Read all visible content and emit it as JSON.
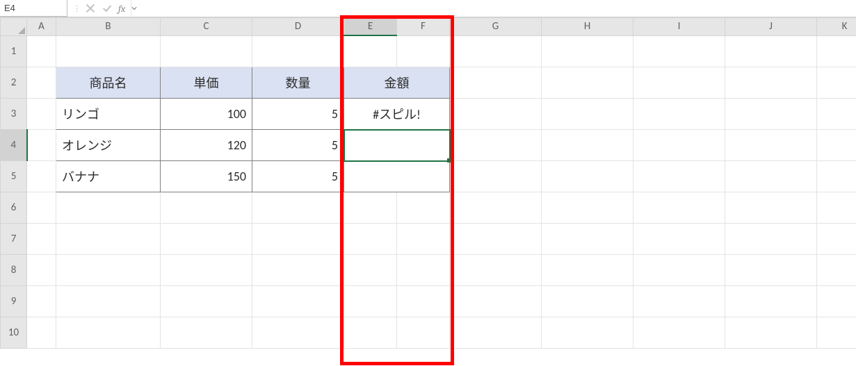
{
  "nameBox": {
    "value": "E4"
  },
  "formulaBar": {
    "fx_label": "fx",
    "value": ""
  },
  "columnHeaders": {
    "A": "A",
    "B": "B",
    "C": "C",
    "D": "D",
    "E": "E",
    "F": "F",
    "G": "G",
    "H": "H",
    "I": "I",
    "J": "J",
    "K": "K"
  },
  "rowHeaders": {
    "1": "1",
    "2": "2",
    "3": "3",
    "4": "4",
    "5": "5",
    "6": "6",
    "7": "7",
    "8": "8",
    "9": "9",
    "10": "10"
  },
  "table": {
    "headers": {
      "product": "商品名",
      "unit_price": "単価",
      "qty": "数量",
      "amount": "金額"
    },
    "rows": [
      {
        "product": "リンゴ",
        "unit_price": "100",
        "qty": "5",
        "amount": "#スピル!"
      },
      {
        "product": "オレンジ",
        "unit_price": "120",
        "qty": "5",
        "amount": ""
      },
      {
        "product": "バナナ",
        "unit_price": "150",
        "qty": "5",
        "amount": ""
      }
    ]
  },
  "activeCell": "E4",
  "annotation": {
    "red_box_covers_columns": [
      "E",
      "F"
    ]
  }
}
